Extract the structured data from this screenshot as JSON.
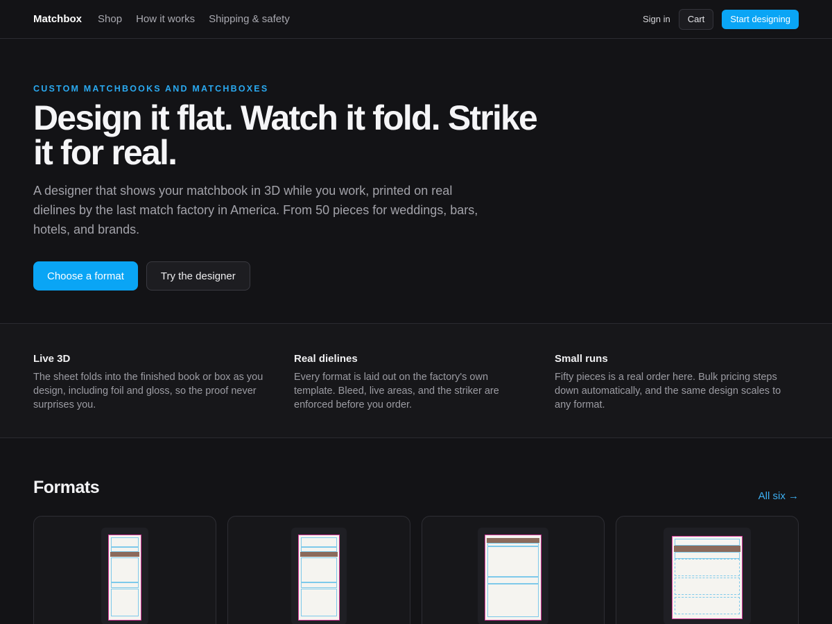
{
  "nav": {
    "brand": "Matchbox",
    "links": [
      "Shop",
      "How it works",
      "Shipping & safety"
    ],
    "signin": "Sign in",
    "cart": "Cart",
    "start": "Start designing"
  },
  "hero": {
    "eyebrow": "CUSTOM MATCHBOOKS AND MATCHBOXES",
    "headline": "Design it flat. Watch it fold. Strike it for real.",
    "lede": "A designer that shows your matchbook in 3D while you work, printed on real dielines by the last match factory in America. From 50 pieces for weddings, bars, hotels, and brands.",
    "primary_cta": "Choose a format",
    "secondary_cta": "Try the designer"
  },
  "features": [
    {
      "title": "Live 3D",
      "body": "The sheet folds into the finished book or box as you design, including foil and gloss, so the proof never surprises you."
    },
    {
      "title": "Real dielines",
      "body": "Every format is laid out on the factory's own template. Bleed, live areas, and the striker are enforced before you order."
    },
    {
      "title": "Small runs",
      "body": "Fifty pieces is a real order here. Bulk pricing steps down automatically, and the same design scales to any format."
    }
  ],
  "formats": {
    "title": "Formats",
    "all_link": "All six →"
  },
  "colors": {
    "background": "#131316",
    "accent": "#0aa5f5",
    "dieline": "#d63a9a",
    "live_area": "#7dc9ea",
    "striker": "#8b6a5b"
  }
}
